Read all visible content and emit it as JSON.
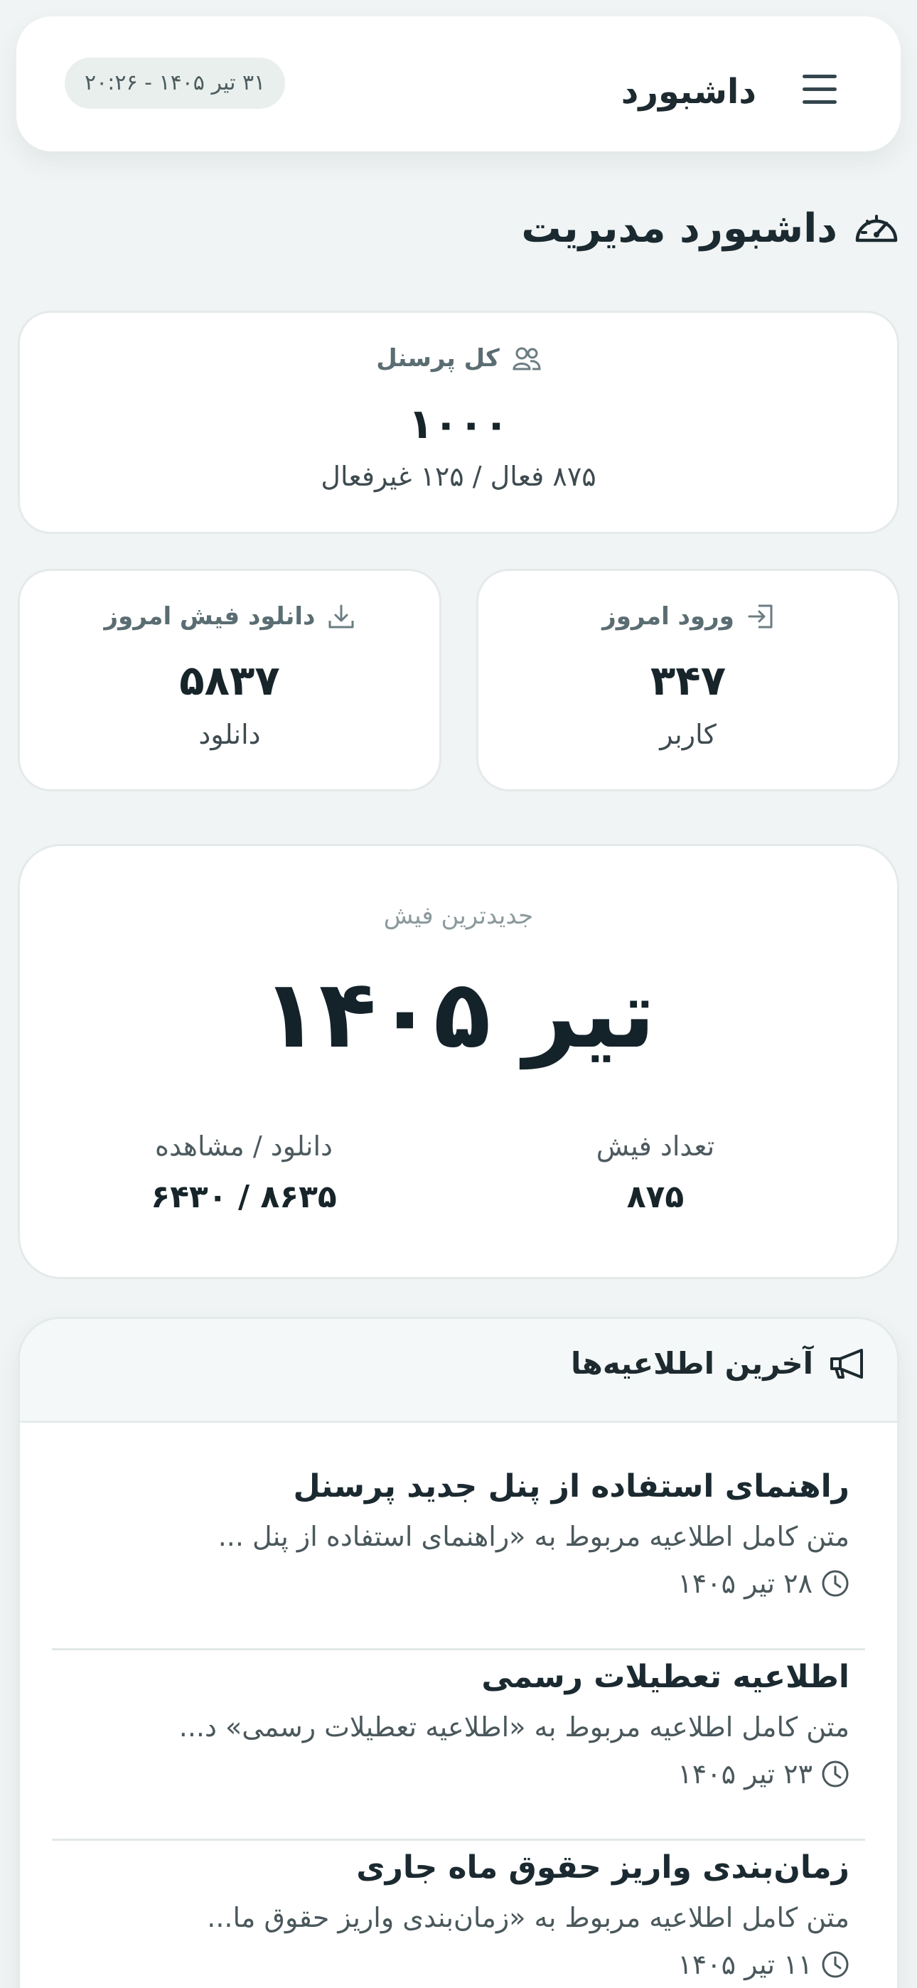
{
  "header": {
    "title": "داشبورد",
    "datetime": "۳۱ تیر ۱۴۰۵ - ۲۰:۲۶",
    "menu_icon": "hamburger-menu-icon"
  },
  "page": {
    "title": "داشبورد مدیریت",
    "icon": "speedometer-icon"
  },
  "stats": {
    "personnel": {
      "label": "کل پرسنل",
      "icon": "users-icon",
      "value": "۱۰۰۰",
      "sub": "۸۷۵ فعال / ۱۲۵ غیرفعال"
    },
    "login": {
      "label": "ورود امروز",
      "icon": "login-icon",
      "value": "۳۴۷",
      "sub": "کاربر"
    },
    "download": {
      "label": "دانلود فیش امروز",
      "icon": "download-icon",
      "value": "۵۸۳۷",
      "sub": "دانلود"
    }
  },
  "latest_slip": {
    "label": "جدیدترین فیش",
    "period": "تیر ۱۴۰۵",
    "count_label": "تعداد فیش",
    "count_value": "۸۷۵",
    "dl_label": "دانلود / مشاهده",
    "dl_value": "۸۶۳۵ / ۶۴۳۰"
  },
  "announcements": {
    "title": "آخرین اطلاعیه‌ها",
    "icon": "megaphone-icon",
    "items": [
      {
        "title": "راهنمای استفاده از پنل جدید پرسنل",
        "body": "متن کامل اطلاعیه مربوط به «راهنمای استفاده از پنل ...",
        "date": "۲۸ تیر ۱۴۰۵"
      },
      {
        "title": "اطلاعیه تعطیلات رسمی",
        "body": "متن کامل اطلاعیه مربوط به «اطلاعیه تعطیلات رسمی» د...",
        "date": "۲۳ تیر ۱۴۰۵"
      },
      {
        "title": "زمان‌بندی واریز حقوق ماه جاری",
        "body": "متن کامل اطلاعیه مربوط به «زمان‌بندی واریز حقوق ما...",
        "date": "۱۱ تیر ۱۴۰۵"
      }
    ]
  }
}
